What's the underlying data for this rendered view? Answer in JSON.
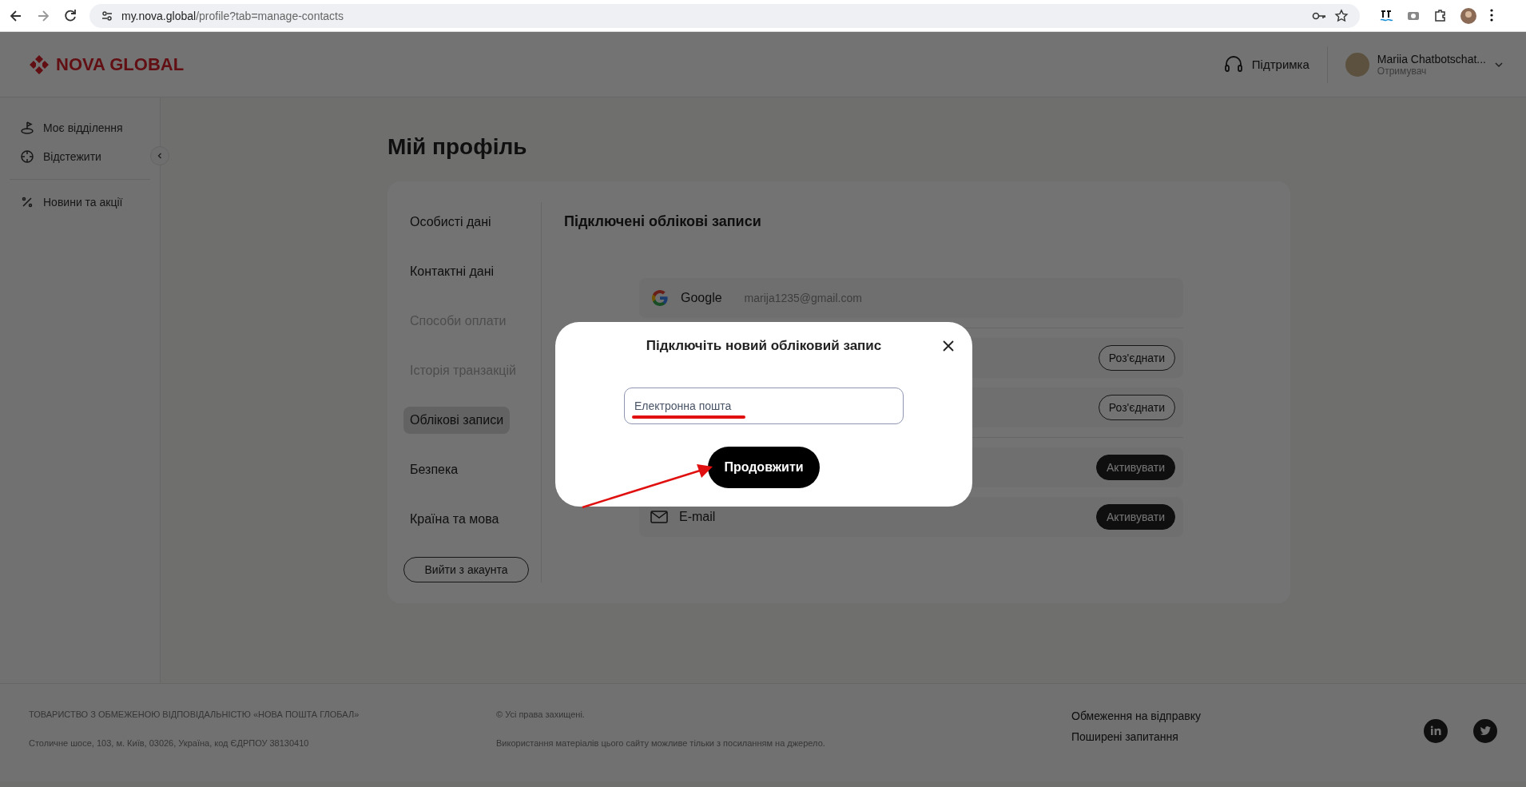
{
  "browser": {
    "url_host": "my.nova.global",
    "url_path": "/profile?tab=manage-contacts"
  },
  "header": {
    "logo": "NOVA GLOBAL",
    "support": "Підтримка",
    "user_name": "Mariia Chatbotschat...",
    "user_role": "Отримувач"
  },
  "sidebar": {
    "items": [
      {
        "kind": "branch",
        "label": "Моє відділення"
      },
      {
        "kind": "track",
        "label": "Відстежити"
      },
      {
        "kind": "news",
        "label": "Новини та акції"
      }
    ]
  },
  "page_title": "Мій профіль",
  "profile_menu": [
    {
      "label": "Особисті дані",
      "selected": false,
      "disabled": false
    },
    {
      "label": "Контактні дані",
      "selected": false,
      "disabled": false
    },
    {
      "label": "Способи оплати",
      "selected": false,
      "disabled": true
    },
    {
      "label": "Історія транзакцій",
      "selected": false,
      "disabled": true
    },
    {
      "label": "Облікові записи",
      "selected": true,
      "disabled": false
    },
    {
      "label": "Безпека",
      "selected": false,
      "disabled": false
    },
    {
      "label": "Країна та мова",
      "selected": false,
      "disabled": false
    }
  ],
  "logout": "Вийти з акаунта",
  "accounts_title": "Підключені облікові записи",
  "accounts": [
    {
      "kind": "google",
      "name": "Google",
      "detail": "marija1235@gmail.com"
    },
    {
      "kind": "hidden",
      "action": {
        "kind": "disconnect",
        "label": "Роз'єднати"
      }
    },
    {
      "kind": "hidden",
      "action": {
        "kind": "disconnect",
        "label": "Роз'єднати"
      }
    },
    {
      "kind": "hidden",
      "action": {
        "kind": "activate",
        "label": "Активувати"
      }
    },
    {
      "kind": "email",
      "name": "E-mail",
      "action": {
        "kind": "activate",
        "label": "Активувати"
      }
    }
  ],
  "modal": {
    "title": "Підключіть новий обліковий запис",
    "placeholder": "Електронна пошта",
    "button": "Продовжити"
  },
  "footer": {
    "company": "ТОВАРИСТВО З ОБМЕЖЕНОЮ ВІДПОВІДАЛЬНІСТЮ «НОВА ПОШТА ГЛОБАЛ»",
    "address": "Столичне шосе, 103, м. Київ, 03026, Україна, код ЄДРПОУ 38130410",
    "rights": "© Усі права захищені.",
    "notice": "Використання матеріалів цього сайту можливе тільки з посиланням на джерело.",
    "links": [
      "Обмеження на відправку",
      "Поширені запитання"
    ]
  }
}
